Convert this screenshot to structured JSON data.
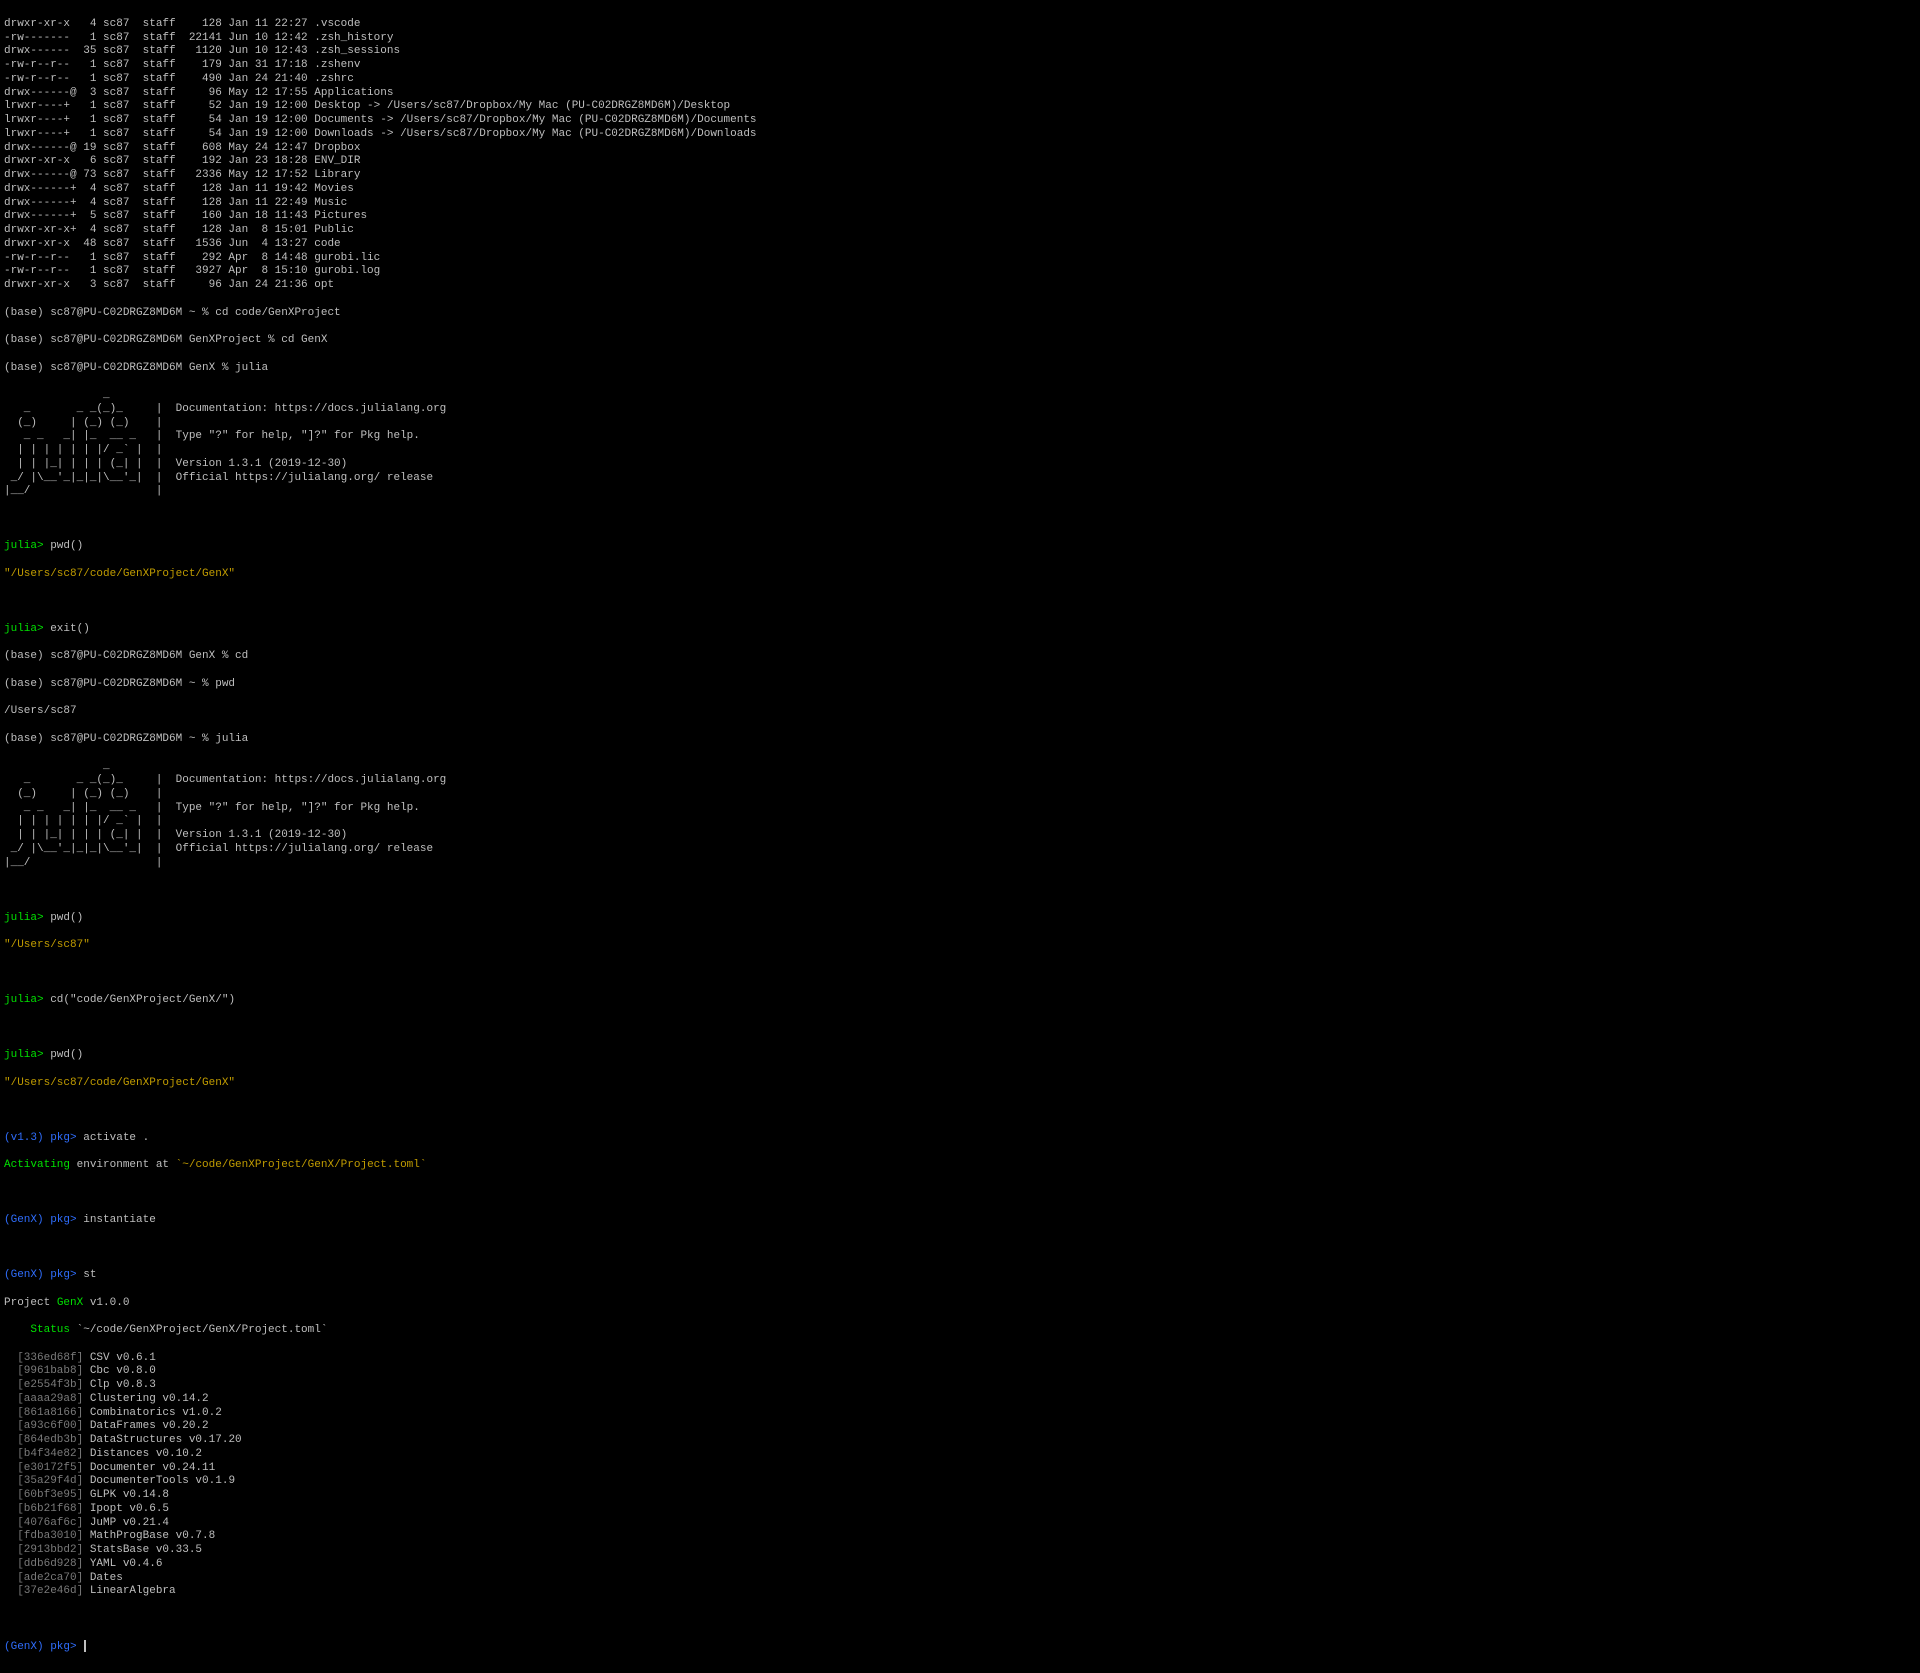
{
  "ls_lines": [
    "drwxr-xr-x   4 sc87  staff    128 Jan 11 22:27 .vscode",
    "-rw-------   1 sc87  staff  22141 Jun 10 12:42 .zsh_history",
    "drwx------  35 sc87  staff   1120 Jun 10 12:43 .zsh_sessions",
    "-rw-r--r--   1 sc87  staff    179 Jan 31 17:18 .zshenv",
    "-rw-r--r--   1 sc87  staff    490 Jan 24 21:40 .zshrc",
    "drwx------@  3 sc87  staff     96 May 12 17:55 Applications",
    "lrwxr----+   1 sc87  staff     52 Jan 19 12:00 Desktop -> /Users/sc87/Dropbox/My Mac (PU-C02DRGZ8MD6M)/Desktop",
    "lrwxr----+   1 sc87  staff     54 Jan 19 12:00 Documents -> /Users/sc87/Dropbox/My Mac (PU-C02DRGZ8MD6M)/Documents",
    "lrwxr----+   1 sc87  staff     54 Jan 19 12:00 Downloads -> /Users/sc87/Dropbox/My Mac (PU-C02DRGZ8MD6M)/Downloads",
    "drwx------@ 19 sc87  staff    608 May 24 12:47 Dropbox",
    "drwxr-xr-x   6 sc87  staff    192 Jan 23 18:28 ENV_DIR",
    "drwx------@ 73 sc87  staff   2336 May 12 17:52 Library",
    "drwx------+  4 sc87  staff    128 Jan 11 19:42 Movies",
    "drwx------+  4 sc87  staff    128 Jan 11 22:49 Music",
    "drwx------+  5 sc87  staff    160 Jan 18 11:43 Pictures",
    "drwxr-xr-x+  4 sc87  staff    128 Jan  8 15:01 Public",
    "drwxr-xr-x  48 sc87  staff   1536 Jun  4 13:27 code",
    "-rw-r--r--   1 sc87  staff    292 Apr  8 14:48 gurobi.lic",
    "-rw-r--r--   1 sc87  staff   3927 Apr  8 15:10 gurobi.log",
    "drwxr-xr-x   3 sc87  staff     96 Jan 24 21:36 opt"
  ],
  "shell_prompts": {
    "p1": "(base) sc87@PU-C02DRGZ8MD6M ~ % cd code/GenXProject",
    "p2": "(base) sc87@PU-C02DRGZ8MD6M GenXProject % cd GenX",
    "p3": "(base) sc87@PU-C02DRGZ8MD6M GenX % julia",
    "p4": "(base) sc87@PU-C02DRGZ8MD6M GenX % cd",
    "p5": "(base) sc87@PU-C02DRGZ8MD6M ~ % pwd",
    "p5_out": "/Users/sc87",
    "p6": "(base) sc87@PU-C02DRGZ8MD6M ~ % julia"
  },
  "julia_banner": {
    "l1": "               _",
    "l2": "   _       _ _(_)_     |  Documentation: https://docs.julialang.org",
    "l3": "  (_)     | (_) (_)    |",
    "l4": "   _ _   _| |_  __ _   |  Type \"?\" for help, \"]?\" for Pkg help.",
    "l5": "  | | | | | | |/ _` |  |",
    "l6": "  | | |_| | | | (_| |  |  Version 1.3.1 (2019-12-30)",
    "l7": " _/ |\\__'_|_|_|\\__'_|  |  Official https://julialang.org/ release",
    "l8": "|__/                   |"
  },
  "julia": {
    "prompt": "julia>",
    "cmd_pwd": " pwd()",
    "pwd1_out": "\"/Users/sc87/code/GenXProject/GenX\"",
    "cmd_exit": " exit()",
    "pwd2_out": "\"/Users/sc87\"",
    "cmd_cd": " cd(\"code/GenXProject/GenX/\")",
    "pwd3_out": "\"/Users/sc87/code/GenXProject/GenX\""
  },
  "pkg": {
    "prompt_v": "(v1.3) pkg>",
    "prompt_genx": "(GenX) pkg>",
    "cmd_activate": " activate .",
    "activating": "Activating",
    "env_at": " environment at ",
    "proj_path": "`~/code/GenXProject/GenX/Project.toml`",
    "cmd_instantiate": " instantiate",
    "cmd_st": " st",
    "project_line_pre": "Project",
    "project_line_name": " GenX",
    "project_line_ver": " v1.0.0",
    "status_label": "    Status",
    "status_path": " `~/code/GenXProject/GenX/Project.toml`",
    "packages": [
      {
        "uuid": "[336ed68f]",
        "rest": " CSV v0.6.1"
      },
      {
        "uuid": "[9961bab8]",
        "rest": " Cbc v0.8.0"
      },
      {
        "uuid": "[e2554f3b]",
        "rest": " Clp v0.8.3"
      },
      {
        "uuid": "[aaaa29a8]",
        "rest": " Clustering v0.14.2"
      },
      {
        "uuid": "[861a8166]",
        "rest": " Combinatorics v1.0.2"
      },
      {
        "uuid": "[a93c6f00]",
        "rest": " DataFrames v0.20.2"
      },
      {
        "uuid": "[864edb3b]",
        "rest": " DataStructures v0.17.20"
      },
      {
        "uuid": "[b4f34e82]",
        "rest": " Distances v0.10.2"
      },
      {
        "uuid": "[e30172f5]",
        "rest": " Documenter v0.24.11"
      },
      {
        "uuid": "[35a29f4d]",
        "rest": " DocumenterTools v0.1.9"
      },
      {
        "uuid": "[60bf3e95]",
        "rest": " GLPK v0.14.8"
      },
      {
        "uuid": "[b6b21f68]",
        "rest": " Ipopt v0.6.5"
      },
      {
        "uuid": "[4076af6c]",
        "rest": " JuMP v0.21.4"
      },
      {
        "uuid": "[fdba3010]",
        "rest": " MathProgBase v0.7.8"
      },
      {
        "uuid": "[2913bbd2]",
        "rest": " StatsBase v0.33.5"
      },
      {
        "uuid": "[ddb6d928]",
        "rest": " YAML v0.4.6"
      },
      {
        "uuid": "[ade2ca70]",
        "rest": " Dates"
      },
      {
        "uuid": "[37e2e46d]",
        "rest": " LinearAlgebra"
      }
    ]
  }
}
